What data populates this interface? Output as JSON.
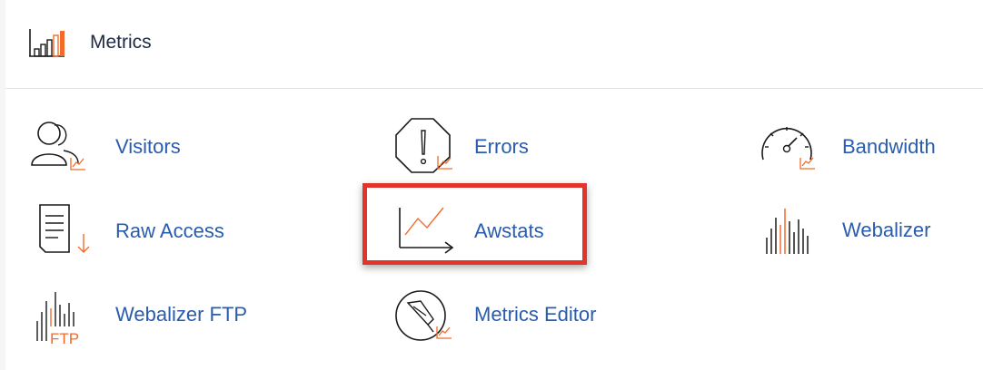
{
  "header": {
    "title": "Metrics",
    "icon": "bar-chart-icon"
  },
  "items": [
    {
      "label": "Visitors",
      "icon": "visitors-icon"
    },
    {
      "label": "Errors",
      "icon": "errors-icon"
    },
    {
      "label": "Bandwidth",
      "icon": "bandwidth-icon"
    },
    {
      "label": "Raw Access",
      "icon": "raw-access-icon"
    },
    {
      "label": "Awstats",
      "icon": "awstats-icon"
    },
    {
      "label": "Webalizer",
      "icon": "webalizer-icon"
    },
    {
      "label": "Webalizer FTP",
      "icon": "webalizer-ftp-icon"
    },
    {
      "label": "Metrics Editor",
      "icon": "metrics-editor-icon"
    }
  ],
  "highlighted_item": "Awstats",
  "icon_text": {
    "ftp": "FTP"
  },
  "colors": {
    "link": "#295cae",
    "accent": "#f26b2a",
    "highlight_border": "#e2342b",
    "title": "#1f2a44"
  }
}
